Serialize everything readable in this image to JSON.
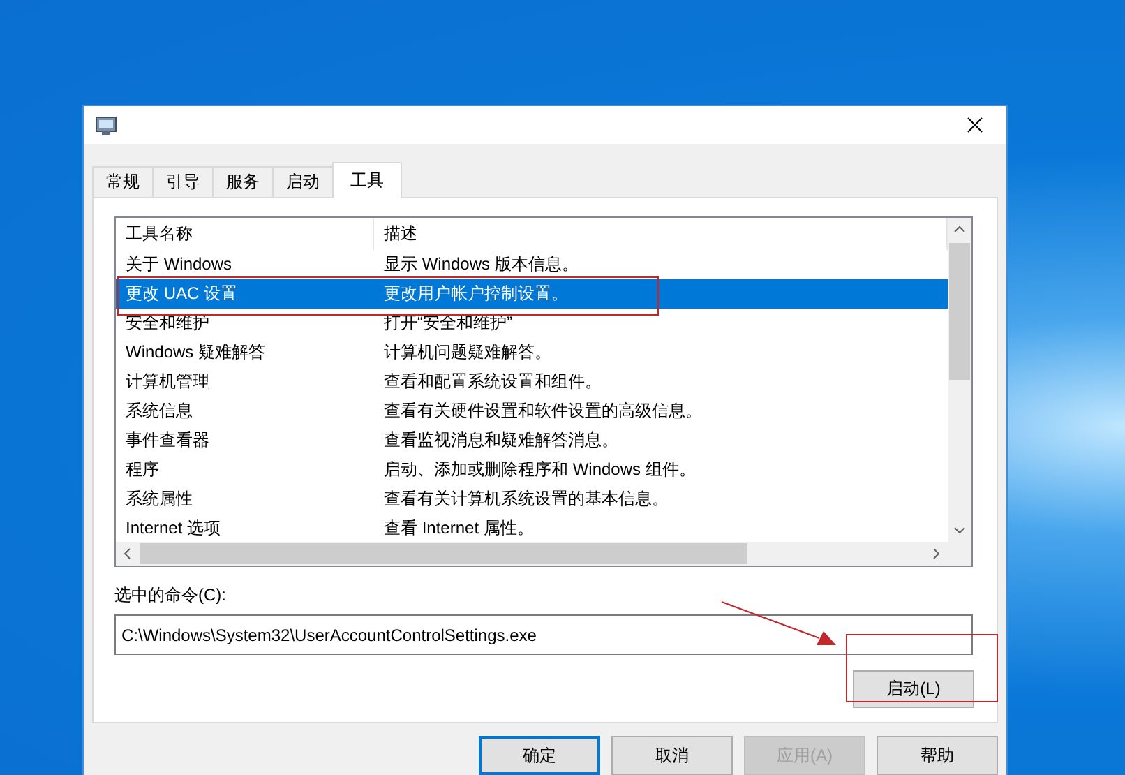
{
  "tabs": [
    {
      "label": "常规",
      "selected": false
    },
    {
      "label": "引导",
      "selected": false
    },
    {
      "label": "服务",
      "selected": false
    },
    {
      "label": "启动",
      "selected": false
    },
    {
      "label": "工具",
      "selected": true
    }
  ],
  "table": {
    "columns": [
      "工具名称",
      "描述"
    ],
    "rows": [
      {
        "name": "关于 Windows",
        "description": "显示 Windows 版本信息。",
        "selected": false
      },
      {
        "name": "更改 UAC 设置",
        "description": "更改用户帐户控制设置。",
        "selected": true
      },
      {
        "name": "安全和维护",
        "description": "打开“安全和维护”",
        "selected": false
      },
      {
        "name": "Windows 疑难解答",
        "description": "计算机问题疑难解答。",
        "selected": false
      },
      {
        "name": "计算机管理",
        "description": "查看和配置系统设置和组件。",
        "selected": false
      },
      {
        "name": "系统信息",
        "description": "查看有关硬件设置和软件设置的高级信息。",
        "selected": false
      },
      {
        "name": "事件查看器",
        "description": "查看监视消息和疑难解答消息。",
        "selected": false
      },
      {
        "name": "程序",
        "description": "启动、添加或删除程序和 Windows 组件。",
        "selected": false
      },
      {
        "name": "系统属性",
        "description": "查看有关计算机系统设置的基本信息。",
        "selected": false
      },
      {
        "name": "Internet 选项",
        "description": "查看 Internet 属性。",
        "selected": false
      }
    ]
  },
  "command": {
    "label": "选中的命令(C):",
    "value": "C:\\Windows\\System32\\UserAccountControlSettings.exe"
  },
  "launch_button": "启动(L)",
  "buttons": [
    {
      "label": "确定",
      "kind": "default",
      "disabled": false
    },
    {
      "label": "取消",
      "kind": "normal",
      "disabled": false
    },
    {
      "label": "应用(A)",
      "kind": "normal",
      "disabled": true
    },
    {
      "label": "帮助",
      "kind": "normal",
      "disabled": false
    }
  ]
}
